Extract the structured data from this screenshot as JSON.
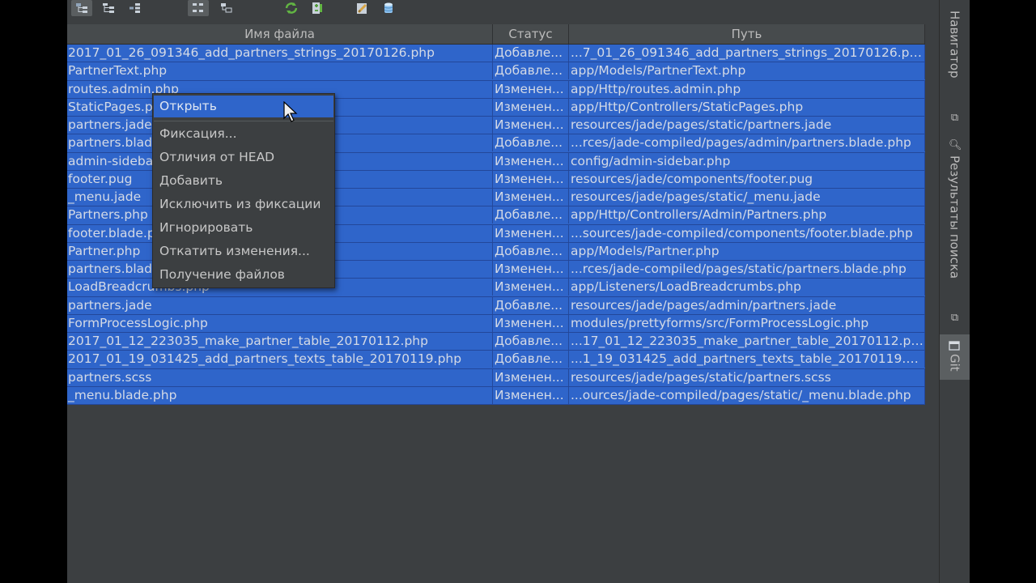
{
  "toolbar": {
    "buttons": [
      {
        "icon": "group-by-directory-icon",
        "pressed": true
      },
      {
        "icon": "expand-all-icon",
        "pressed": false
      },
      {
        "icon": "collapse-all-icon",
        "pressed": false
      },
      {
        "icon": "show-flat-icon",
        "pressed": true
      },
      {
        "icon": "show-tree-icon",
        "pressed": false
      },
      {
        "icon": "refresh-icon",
        "pressed": false
      },
      {
        "icon": "diff-icon",
        "pressed": false
      },
      {
        "icon": "edit-source-icon",
        "pressed": false
      },
      {
        "icon": "database-icon",
        "pressed": false
      }
    ]
  },
  "table": {
    "headers": {
      "name": "Имя файла",
      "status": "Статус",
      "path": "Путь"
    },
    "rows": [
      {
        "name": "2017_01_26_091346_add_partners_strings_20170126.php",
        "status": "Добавле...",
        "path": "...7_01_26_091346_add_partners_strings_20170126.php"
      },
      {
        "name": "PartnerText.php",
        "status": "Добавле...",
        "path": "app/Models/PartnerText.php"
      },
      {
        "name": "routes.admin.php",
        "status": "Изменен...",
        "path": "app/Http/routes.admin.php"
      },
      {
        "name": "StaticPages.php",
        "status": "Изменен...",
        "path": "app/Http/Controllers/StaticPages.php"
      },
      {
        "name": "partners.jade",
        "status": "Изменен...",
        "path": "resources/jade/pages/static/partners.jade"
      },
      {
        "name": "partners.blade.php",
        "status": "Добавле...",
        "path": "...rces/jade-compiled/pages/admin/partners.blade.php"
      },
      {
        "name": "admin-sidebar.php",
        "status": "Изменен...",
        "path": "config/admin-sidebar.php"
      },
      {
        "name": "footer.pug",
        "status": "Изменен...",
        "path": "resources/jade/components/footer.pug"
      },
      {
        "name": "_menu.jade",
        "status": "Изменен...",
        "path": "resources/jade/pages/static/_menu.jade"
      },
      {
        "name": "Partners.php",
        "status": "Добавле...",
        "path": "app/Http/Controllers/Admin/Partners.php"
      },
      {
        "name": "footer.blade.php",
        "status": "Изменен...",
        "path": "...sources/jade-compiled/components/footer.blade.php"
      },
      {
        "name": "Partner.php",
        "status": "Добавле...",
        "path": "app/Models/Partner.php"
      },
      {
        "name": "partners.blade.php",
        "status": "Изменен...",
        "path": "...rces/jade-compiled/pages/static/partners.blade.php"
      },
      {
        "name": "LoadBreadcrumbs.php",
        "status": "Изменен...",
        "path": "app/Listeners/LoadBreadcrumbs.php"
      },
      {
        "name": "partners.jade",
        "status": "Добавле...",
        "path": "resources/jade/pages/admin/partners.jade"
      },
      {
        "name": "FormProcessLogic.php",
        "status": "Изменен...",
        "path": "modules/prettyforms/src/FormProcessLogic.php"
      },
      {
        "name": "2017_01_12_223035_make_partner_table_20170112.php",
        "status": "Добавле...",
        "path": "...17_01_12_223035_make_partner_table_20170112.php"
      },
      {
        "name": "2017_01_19_031425_add_partners_texts_table_20170119.php",
        "status": "Добавле...",
        "path": "...1_19_031425_add_partners_texts_table_20170119.php"
      },
      {
        "name": "partners.scss",
        "status": "Изменен...",
        "path": "resources/jade/pages/static/partners.scss"
      },
      {
        "name": "_menu.blade.php",
        "status": "Изменен...",
        "path": "...ources/jade-compiled/pages/static/_menu.blade.php"
      }
    ]
  },
  "context_menu": {
    "items": [
      {
        "label": "Открыть",
        "selected": true
      },
      {
        "label": "Фиксация...",
        "selected": false
      },
      {
        "label": "Отличия от HEAD",
        "selected": false
      },
      {
        "label": "Добавить",
        "selected": false
      },
      {
        "label": "Исключить из фиксации",
        "selected": false
      },
      {
        "label": "Игнорировать",
        "selected": false
      },
      {
        "label": "Откатить изменения...",
        "selected": false
      },
      {
        "label": "Получение файлов",
        "selected": false
      }
    ]
  },
  "tool_windows": {
    "navigator": "Навигатор",
    "search_results": "Результаты поиска",
    "git": "Git"
  },
  "colors": {
    "selection": "#2f65ca",
    "panel": "#3c3f41",
    "text": "#d4dae6"
  }
}
